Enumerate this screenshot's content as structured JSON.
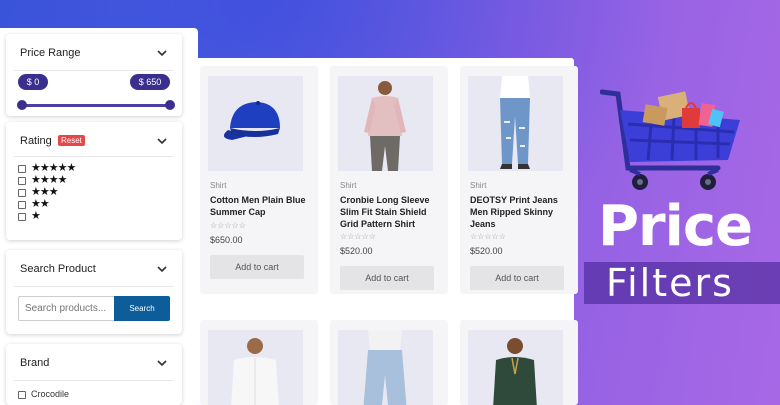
{
  "sidebar": {
    "price_range": {
      "title": "Price Range",
      "min_label": "$ 0",
      "max_label": "$ 650",
      "min_fraction": 0.0,
      "max_fraction": 1.0
    },
    "rating": {
      "title": "Rating",
      "reset_label": "Reset",
      "options": [
        {
          "stars": "★★★★★"
        },
        {
          "stars": "★★★★"
        },
        {
          "stars": "★★★"
        },
        {
          "stars": "★★"
        },
        {
          "stars": "★"
        }
      ]
    },
    "search": {
      "title": "Search Product",
      "placeholder": "Search products...",
      "button_label": "Search"
    },
    "brand": {
      "title": "Brand",
      "items": [
        "Crocodile"
      ]
    }
  },
  "products": [
    {
      "category": "Shirt",
      "name": "Cotton Men Plain Blue Summer Cap",
      "stars": "☆☆☆☆☆",
      "price": "$650.00",
      "button": "Add to cart",
      "image": "blue-cap"
    },
    {
      "category": "Shirt",
      "name": "Cronbie Long Sleeve Slim Fit Stain Shield Grid Pattern Shirt",
      "stars": "☆☆☆☆☆",
      "price": "$520.00",
      "button": "Add to cart",
      "image": "pink-shirt-man"
    },
    {
      "category": "Shirt",
      "name": "DEOTSY Print Jeans Men Ripped Skinny Jeans",
      "stars": "☆☆☆☆☆",
      "price": "$520.00",
      "button": "Add to cart",
      "image": "ripped-jeans-man"
    },
    {
      "image": "white-shirt-man"
    },
    {
      "image": "light-jeans-man"
    },
    {
      "image": "green-kurta-man"
    }
  ],
  "banner": {
    "title_line1": "Price",
    "title_line2": "Filters"
  },
  "colors": {
    "accent": "#3a2f8f",
    "search_button": "#0c5d9a",
    "reset_badge": "#e54848",
    "cart_blue": "#3b3fd8"
  }
}
